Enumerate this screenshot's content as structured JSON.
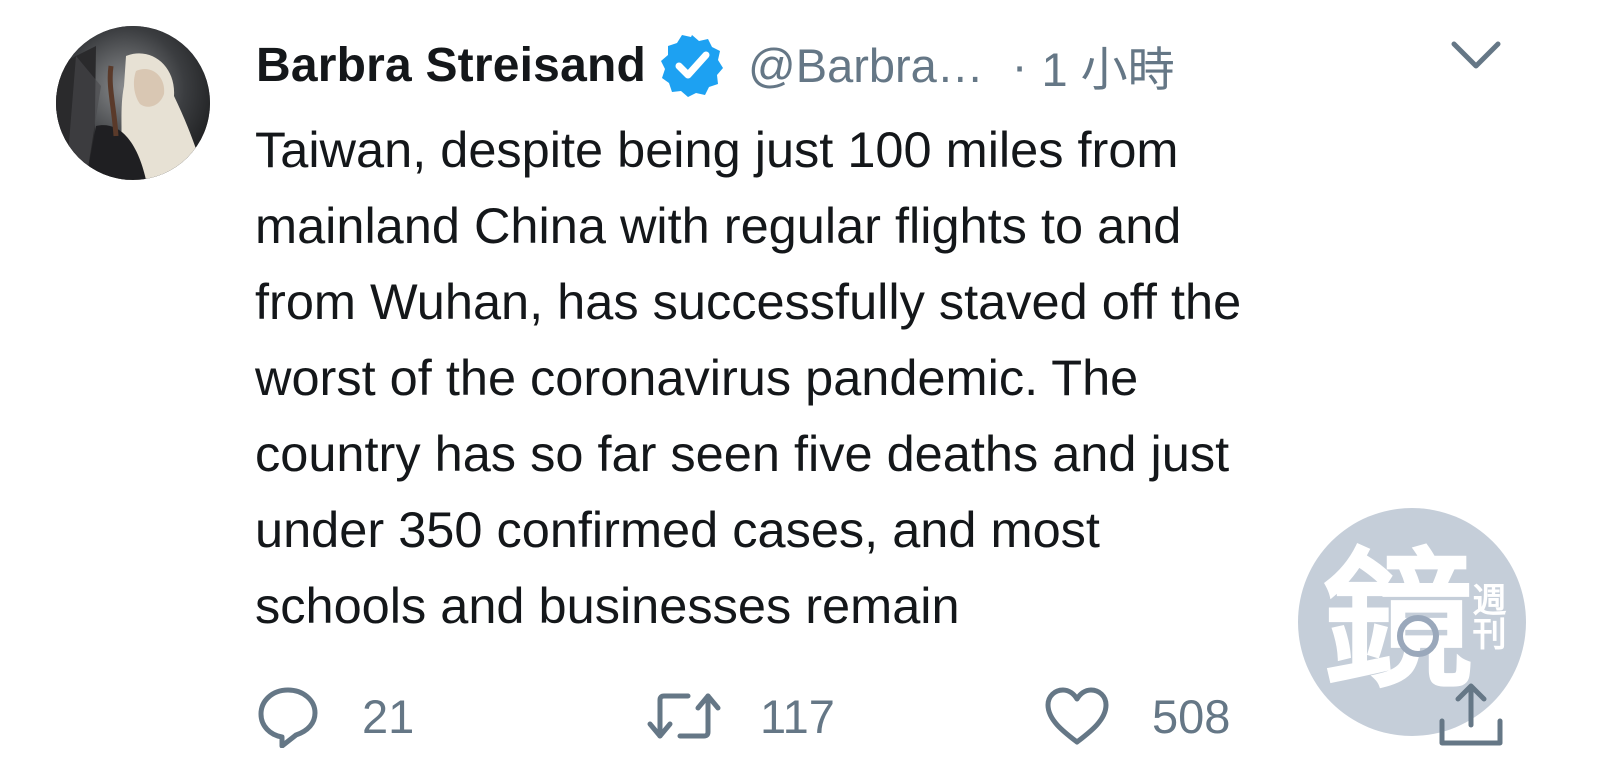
{
  "tweet": {
    "author_name": "Barbra Streisand",
    "handle": "@Barbra…",
    "separator": "·",
    "time": "1 小時",
    "verified_icon": "verified-badge-icon",
    "verified_color": "#1da1f2",
    "text_lines": [
      "Taiwan, despite being just 100 miles from",
      "mainland China with regular flights to and",
      "from Wuhan, has successfully staved off the",
      "worst of the coronavirus pandemic. The",
      "country has so far seen five deaths and just",
      "under 350 confirmed cases, and most",
      "schools and businesses remain"
    ]
  },
  "actions": {
    "reply": {
      "icon": "reply-icon",
      "count": "21"
    },
    "retweet": {
      "icon": "retweet-icon",
      "count": "117"
    },
    "like": {
      "icon": "heart-icon",
      "count": "508"
    },
    "share": {
      "icon": "share-icon"
    }
  },
  "watermark": {
    "text_main": "鏡",
    "text_side": "週刊"
  },
  "colors": {
    "primary_text": "#14171a",
    "secondary_text": "#657786",
    "accent": "#1da1f2"
  }
}
